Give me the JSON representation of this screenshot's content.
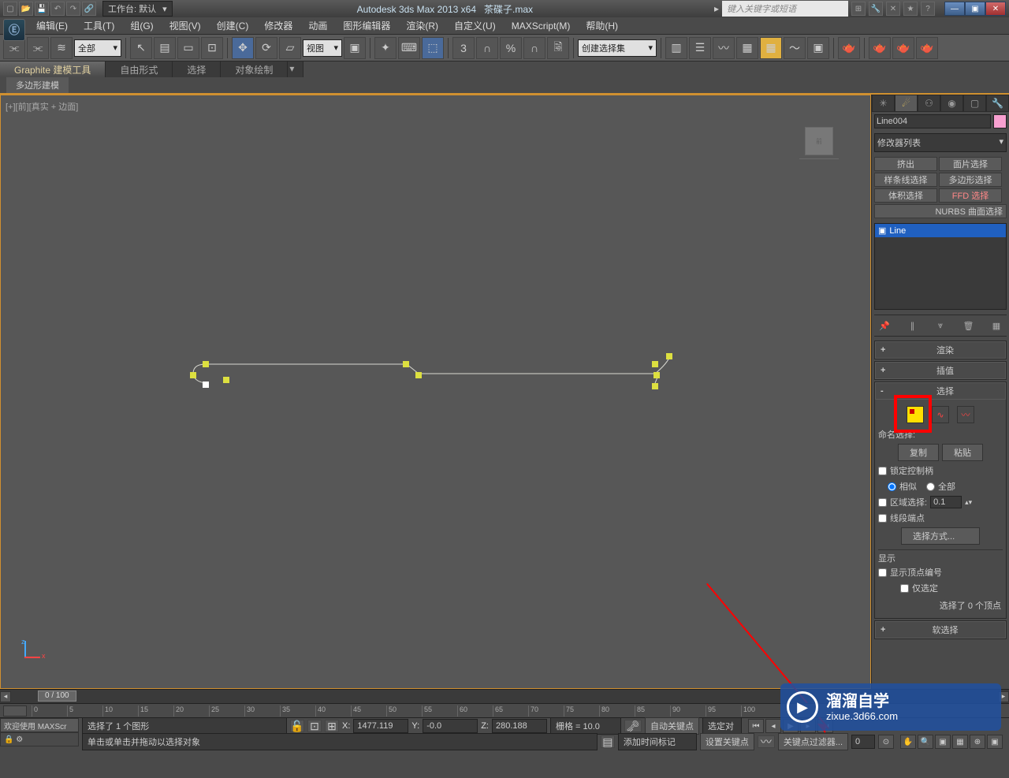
{
  "title": {
    "app": "Autodesk 3ds Max  2013 x64",
    "file": "茶碟子.max",
    "workspace": "工作台: 默认",
    "search_placeholder": "键入关键字或短语"
  },
  "menu": [
    "编辑(E)",
    "工具(T)",
    "组(G)",
    "视图(V)",
    "创建(C)",
    "修改器",
    "动画",
    "图形编辑器",
    "渲染(R)",
    "自定义(U)",
    "MAXScript(M)",
    "帮助(H)"
  ],
  "toolbar": {
    "filter": "全部",
    "coord": "视图",
    "selset": "创建选择集"
  },
  "ribbon": {
    "tabs": [
      "Graphite 建模工具",
      "自由形式",
      "选择",
      "对象绘制"
    ],
    "sub": "多边形建模"
  },
  "viewport": {
    "label": "[+][前][真实 + 边面]"
  },
  "cmdpanel": {
    "obj_name": "Line004",
    "modlist_label": "修改器列表",
    "mod_buttons": [
      "挤出",
      "面片选择",
      "样条线选择",
      "多边形选择",
      "体积选择",
      "FFD 选择"
    ],
    "nurbs_btn": "NURBS 曲面选择",
    "stack_item": "Line",
    "rollouts": {
      "render": "渲染",
      "interp": "插值",
      "selection": "选择",
      "softsel": "软选择",
      "named": "命名选择:",
      "copy": "复制",
      "paste": "粘贴",
      "lock_handles": "锁定控制柄",
      "similar": "相似",
      "all": "全部",
      "area_sel": "区域选择:",
      "area_val": "0.1",
      "seg_end": "线段端点",
      "sel_method": "选择方式...",
      "display": "显示",
      "show_vert_num": "显示顶点编号",
      "only_sel": "仅选定",
      "sel_count": "选择了 0 个顶点"
    }
  },
  "timeline": {
    "handle": "0 / 100",
    "ticks": [
      "0",
      "5",
      "10",
      "15",
      "20",
      "25",
      "30",
      "35",
      "40",
      "45",
      "50",
      "55",
      "60",
      "65",
      "70",
      "75",
      "80",
      "85",
      "90",
      "95",
      "100"
    ]
  },
  "status": {
    "sel": "选择了 1 个图形",
    "prompt": "单击或单击并拖动以选择对象",
    "x": "1477.119",
    "y": "-0.0",
    "z": "280.188",
    "grid": "栅格 = 10.0",
    "autokey": "自动关键点",
    "setkey": "设置关键点",
    "keyfilter": "关键点过滤器...",
    "addmarker": "添加时间标记",
    "welcome": "欢迎使用  MAXScr",
    "selset": "选定对"
  },
  "watermark": {
    "brand": "溜溜自学",
    "url": "zixue.3d66.com"
  }
}
